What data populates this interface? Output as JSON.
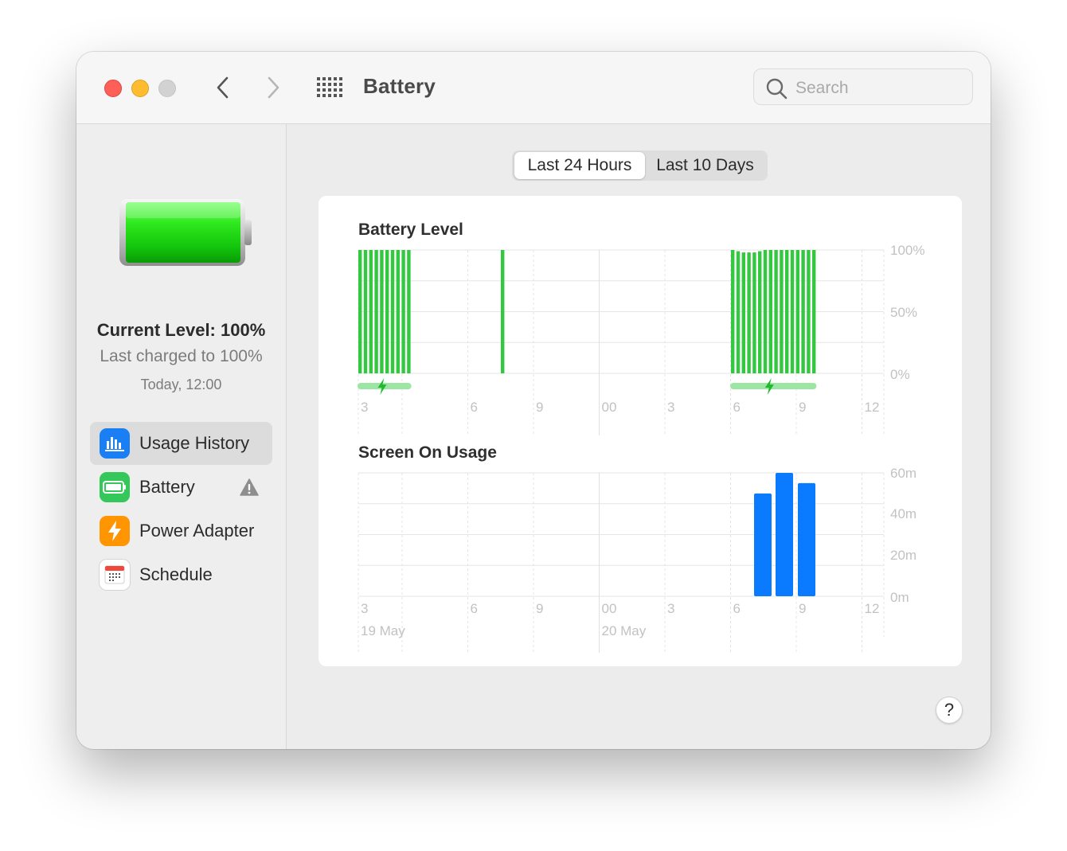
{
  "window": {
    "title": "Battery"
  },
  "search": {
    "placeholder": "Search"
  },
  "icons": {
    "back": "chevron-left-icon",
    "forward": "chevron-right-icon",
    "grid": "grid-icon",
    "search": "search-icon",
    "help": "help-icon"
  },
  "status": {
    "current_level": "Current Level: 100%",
    "last_charged": "Last charged to 100%",
    "time": "Today, 12:00"
  },
  "sidebar": {
    "items": [
      {
        "label": "Usage History",
        "icon": "bar-chart-icon",
        "color": "#1a7ff5",
        "selected": true
      },
      {
        "label": "Battery",
        "icon": "battery-icon",
        "color": "#34c759",
        "selected": false,
        "warning": true
      },
      {
        "label": "Power Adapter",
        "icon": "lightning-icon",
        "color": "#ff9500",
        "selected": false
      },
      {
        "label": "Schedule",
        "icon": "calendar-icon",
        "color": "#ffffff",
        "selected": false
      }
    ]
  },
  "tabs": [
    {
      "label": "Last 24 Hours",
      "active": true
    },
    {
      "label": "Last 10 Days",
      "active": false
    }
  ],
  "help_label": "?",
  "colors": {
    "battery_green": "#33c840",
    "charging_green": "#9be6a3",
    "usage_blue": "#0a7aff"
  },
  "chart_data": [
    {
      "type": "bar",
      "title": "Battery Level",
      "x_tick_labels": [
        "3",
        "6",
        "9",
        "00",
        "3",
        "6",
        "9",
        "12"
      ],
      "y_tick_labels": [
        "100%",
        "50%",
        "0%"
      ],
      "ylim": [
        0,
        100
      ],
      "bar_groups": [
        {
          "start_hour": 2.0,
          "bars": 10,
          "values": [
            100,
            100,
            100,
            100,
            100,
            100,
            100,
            100,
            100,
            100
          ],
          "charging": true
        },
        {
          "start_hour": 9.5,
          "bars": 1,
          "values": [
            100
          ],
          "charging": false
        },
        {
          "start_hour": 19.0,
          "bars": 16,
          "values": [
            100,
            99,
            98,
            98,
            98,
            99,
            100,
            100,
            100,
            100,
            100,
            100,
            100,
            100,
            100,
            100
          ],
          "charging": true
        }
      ]
    },
    {
      "type": "bar",
      "title": "Screen On Usage",
      "x_tick_labels": [
        "3",
        "6",
        "9",
        "00",
        "3",
        "6",
        "9",
        "12"
      ],
      "date_labels": [
        "19 May",
        "20 May"
      ],
      "y_tick_labels": [
        "60m",
        "40m",
        "20m",
        "0m"
      ],
      "ylim": [
        0,
        60
      ],
      "values": [
        {
          "hour": 20,
          "minutes": 50
        },
        {
          "hour": 21,
          "minutes": 60
        },
        {
          "hour": 22,
          "minutes": 55
        }
      ]
    }
  ]
}
